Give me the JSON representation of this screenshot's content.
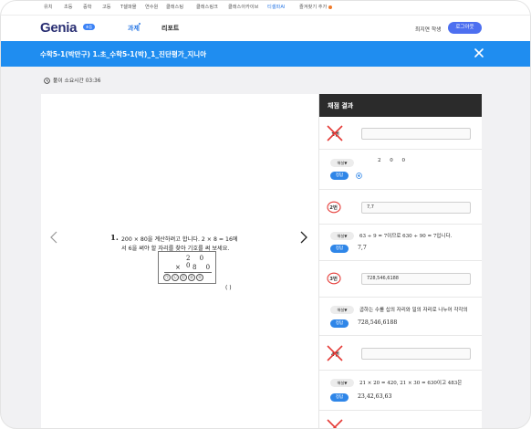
{
  "site_nav": {
    "items": [
      "유치",
      "초등",
      "중학",
      "고등",
      "T셀파몰",
      "연수원",
      "클래스팅",
      "클래스링크",
      "클래스아카이브",
      "티셀파AI",
      "즐겨찾기 추가"
    ]
  },
  "header": {
    "logo": "Genia",
    "badge": "초등",
    "menu": [
      "과제",
      "리포트"
    ],
    "username": "최지연 학생",
    "login_button": "로그아웃"
  },
  "assignment_bar": {
    "title": "수학5-1(박만구) 1.초_수학5-1(박)_1_진단평가_지니아"
  },
  "timer": {
    "label": "풀이 소요시간",
    "time": "03:36"
  },
  "question": {
    "number": "1.",
    "line1": "200 × 80을 계산하려고 합니다. 2 × 8 = 16에",
    "line2": "서 6을 써야 할 자리를 찾아 기호를 써 보세요.",
    "top_digits": "2 0 0",
    "times": "×",
    "bottom_digits": "8 0",
    "symbols": [
      "㉠",
      "㉡",
      "㉢",
      "㉣",
      "㉤"
    ],
    "answer_blank": "(        )"
  },
  "grading": {
    "header": "채점 결과",
    "explain_label": "해설▼",
    "answer_label": "정답",
    "rows": [
      {
        "num": "1번",
        "result": "wrong",
        "student_answer": "",
        "explanation": "2 0 0",
        "correct": ""
      },
      {
        "num": "2번",
        "result": "correct",
        "student_answer": "7,7",
        "explanation": "63 ÷ 9 = 7이므로 630 ÷ 90 = 7입니다.",
        "correct": "7,7"
      },
      {
        "num": "3번",
        "result": "correct",
        "student_answer": "728,546,6188",
        "explanation": "곱하는 수를 십의 자리와 일의 자리로 나누어 각각의",
        "correct": "728,546,6188"
      },
      {
        "num": "4번",
        "result": "wrong",
        "student_answer": "",
        "explanation": "21 × 20 = 420, 21 × 30 = 630이고 483은",
        "correct": "23,42,63,63"
      }
    ]
  },
  "colors": {
    "accent": "#1f8df0",
    "wrong_mark": "#e53935",
    "correct_circle": "#e53935",
    "answer_pill": "#2f86e8"
  }
}
